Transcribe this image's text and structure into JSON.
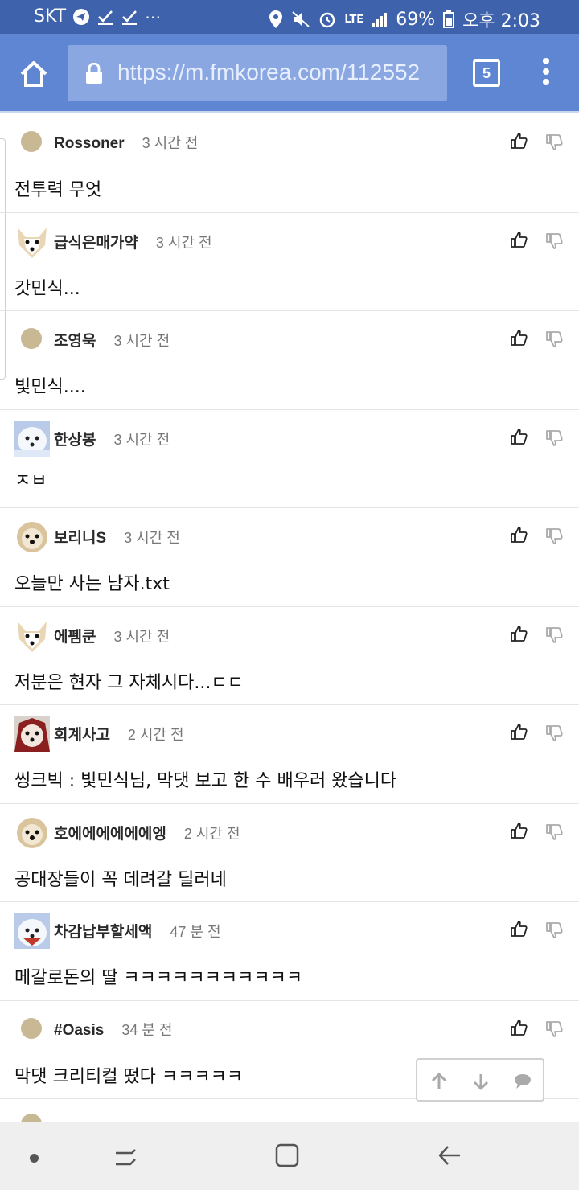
{
  "status_bar": {
    "carrier": "SKT",
    "network": "LTE",
    "battery": "69%",
    "time": "오후 2:03"
  },
  "browser": {
    "url": "https://m.fmkorea.com/112552",
    "tab_count": "5"
  },
  "comments": [
    {
      "author": "Rossoner",
      "time": "3 시간 전",
      "text": "전투력 무엇",
      "avatar": "dot"
    },
    {
      "author": "급식은매가약",
      "time": "3 시간 전",
      "text": "갓민식...",
      "avatar": "fox-avatar"
    },
    {
      "author": "조영욱",
      "time": "3 시간 전",
      "text": "빛민식....",
      "avatar": "dot"
    },
    {
      "author": "한상봉",
      "time": "3 시간 전",
      "text": "ㅈㅂ",
      "avatar": "white-dog-avatar"
    },
    {
      "author": "보리니S",
      "time": "3 시간 전",
      "text": "오늘만 사는 남자.txt",
      "avatar": "puppy-avatar"
    },
    {
      "author": "에펨쿤",
      "time": "3 시간 전",
      "text": "저분은 현자 그 자체시다...ㄷㄷ",
      "avatar": "fox-avatar"
    },
    {
      "author": "회계사고",
      "time": "2 시간 전",
      "text": "씽크빅 : 빛민식님, 막댓 보고 한 수 배우러 왔습니다",
      "avatar": "red-puppy-avatar"
    },
    {
      "author": "호에에에에에에엥",
      "time": "2 시간 전",
      "text": "공대장들이 꼭 데려갈 딜러네",
      "avatar": "puppy-avatar"
    },
    {
      "author": "차감납부할세액",
      "time": "47 분 전",
      "text": "메갈로돈의 딸 ㅋㅋㅋㅋㅋㅋㅋㅋㅋㅋㅋ",
      "avatar": "white-dog-avatar"
    },
    {
      "author": "#Oasis",
      "time": "34 분 전",
      "text": "막댓 크리티컬 떴다 ㅋㅋㅋㅋㅋ",
      "avatar": "dot"
    }
  ],
  "colors": {
    "status_bar": "#3f62ad",
    "toolbar": "#5f86d3",
    "url_bar": "#8aa7e2"
  }
}
